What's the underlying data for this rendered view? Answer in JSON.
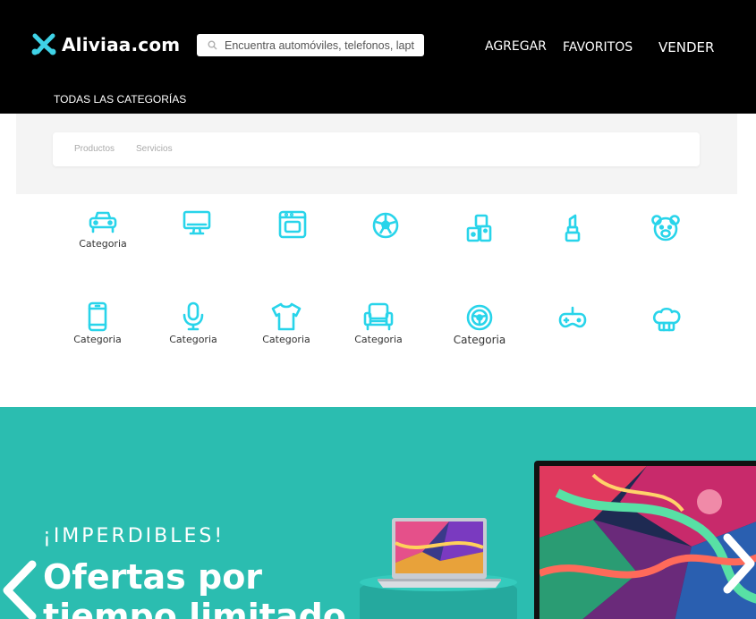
{
  "header": {
    "logo_text": "Aliviaa.com",
    "search_placeholder": "Encuentra automóviles, telefonos, laptop",
    "nav": {
      "agregar": "AGREGAR",
      "favoritos": "FAVORITOS",
      "vender": "VENDER"
    },
    "all_categories": "TODAS LAS CATEGORÍAS"
  },
  "tabs": {
    "productos": "Productos",
    "servicios": "Servicios"
  },
  "categories": [
    {
      "icon": "car-icon",
      "label": "Categoria"
    },
    {
      "icon": "monitor-icon",
      "label": ""
    },
    {
      "icon": "oven-icon",
      "label": ""
    },
    {
      "icon": "soccer-ball-icon",
      "label": ""
    },
    {
      "icon": "toy-blocks-icon",
      "label": ""
    },
    {
      "icon": "lipstick-icon",
      "label": ""
    },
    {
      "icon": "teddy-bear-icon",
      "label": ""
    },
    {
      "icon": "phone-icon",
      "label": "Categoria"
    },
    {
      "icon": "microphone-icon",
      "label": "Categoria"
    },
    {
      "icon": "tshirt-icon",
      "label": "Categoria"
    },
    {
      "icon": "armchair-icon",
      "label": "Categoria"
    },
    {
      "icon": "steering-wheel-icon",
      "label": "Categoria"
    },
    {
      "icon": "gamepad-icon",
      "label": ""
    },
    {
      "icon": "chef-hat-icon",
      "label": ""
    }
  ],
  "banner": {
    "kicker": "¡IMPERDIBLES!",
    "title_line1": "Ofertas por",
    "title_line2": "tiempo limitado"
  },
  "colors": {
    "header_bg": "#000000",
    "accent": "#28d4ea",
    "banner_bg": "#2bbdb0"
  }
}
